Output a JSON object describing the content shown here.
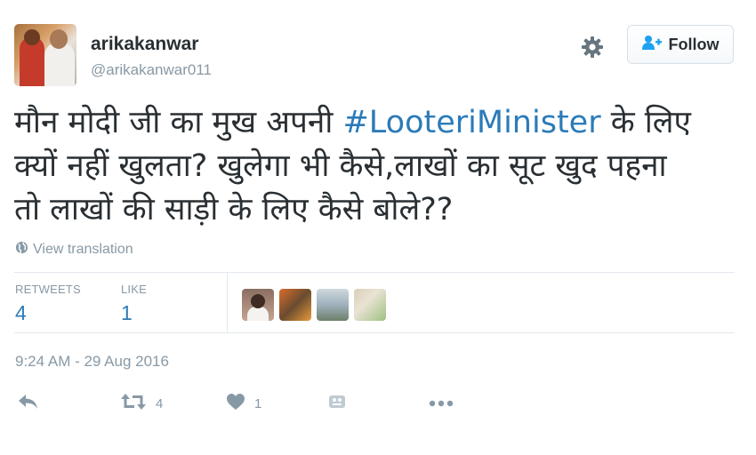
{
  "user": {
    "fullname": "arikakanwar",
    "screen_name": "@arikakanwar011"
  },
  "follow_button": {
    "label": "Follow"
  },
  "tweet": {
    "text_lines": [
      {
        "before": "मौन मोदी जी का मुख अपनी ",
        "hashtag": "#LooteriMinister",
        "after": " के लिए"
      },
      {
        "before": "क्यों नहीं खुलता? खुलेगा भी कैसे,लाखों का सूट खुद पहना",
        "hashtag": "",
        "after": ""
      },
      {
        "before": "तो लाखों की साड़ी के लिए कैसे बोले??",
        "hashtag": "",
        "after": ""
      }
    ],
    "translation_link": "View translation",
    "timestamp": "9:24 AM - 29 Aug 2016"
  },
  "stats": {
    "retweets_label": "RETWEETS",
    "retweets_count": "4",
    "likes_label": "LIKE",
    "likes_count": "1"
  },
  "actions": {
    "reply_icon": "reply-icon",
    "retweet_icon": "retweet-icon",
    "retweet_count": "4",
    "like_icon": "heart-icon",
    "like_count": "1",
    "mod_icon": "tweet-stats-icon",
    "more_icon": "more-icon"
  },
  "colors": {
    "link": "#2b7bb9",
    "secondary_text": "#8899a6",
    "primary_text": "#292f33",
    "divider": "#e1e8ed"
  }
}
